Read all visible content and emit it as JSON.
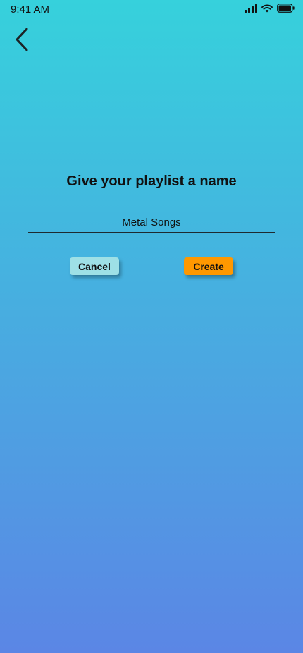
{
  "status_bar": {
    "time": "9:41 AM",
    "icons": [
      "signal-icon",
      "wifi-icon",
      "battery-icon"
    ]
  },
  "nav": {
    "back_icon": "chevron-left-icon"
  },
  "dialog": {
    "title": "Give your playlist a name",
    "name_value": "Metal Songs",
    "cancel_label": "Cancel",
    "create_label": "Create"
  },
  "colors": {
    "gradient_top": "#36d1dc",
    "gradient_bottom": "#5b86e5",
    "cancel_button": "#9ee0e6",
    "create_button": "#ff9800"
  }
}
